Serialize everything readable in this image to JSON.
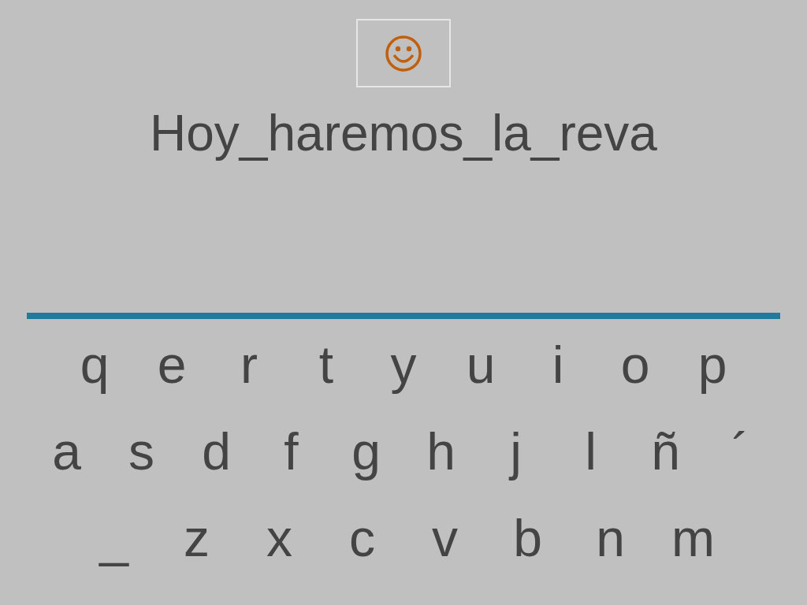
{
  "phrase": "Hoy_haremos_la_reva",
  "keyboard": [
    {
      "keys": [
        "q",
        "e",
        "r",
        "t",
        "y",
        "u",
        "i",
        "o",
        "p"
      ]
    },
    {
      "keys": [
        "a",
        "s",
        "d",
        "f",
        "g",
        "h",
        "j",
        "l",
        "ñ",
        "´"
      ]
    },
    {
      "keys": [
        "_",
        "z",
        "x",
        "c",
        "v",
        "b",
        "n",
        "m"
      ]
    }
  ]
}
